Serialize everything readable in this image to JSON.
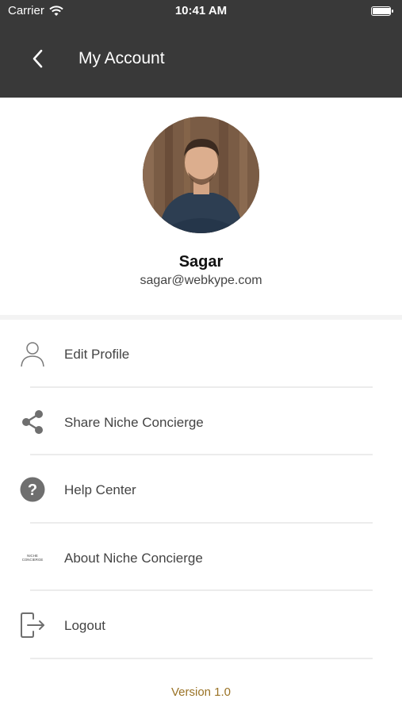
{
  "status_bar": {
    "carrier": "Carrier",
    "time": "10:41 AM",
    "wifi_icon": "wifi-icon",
    "battery_icon": "battery-icon"
  },
  "nav": {
    "title": "My Account",
    "back_icon": "chevron-left-icon"
  },
  "profile": {
    "name": "Sagar",
    "email": "sagar@webkype.com"
  },
  "menu": [
    {
      "label": "Edit Profile",
      "icon": "user-icon"
    },
    {
      "label": "Share Niche Concierge",
      "icon": "share-icon"
    },
    {
      "label": "Help Center",
      "icon": "help-icon"
    },
    {
      "label": "About Niche Concierge",
      "icon": "brand-logo-icon",
      "logo_text": "NICHE CONCIERGE"
    },
    {
      "label": "Logout",
      "icon": "logout-icon"
    }
  ],
  "version": "Version 1.0",
  "colors": {
    "header": "#393939",
    "accent": "#9a7326",
    "icon": "#6f6f6f"
  }
}
